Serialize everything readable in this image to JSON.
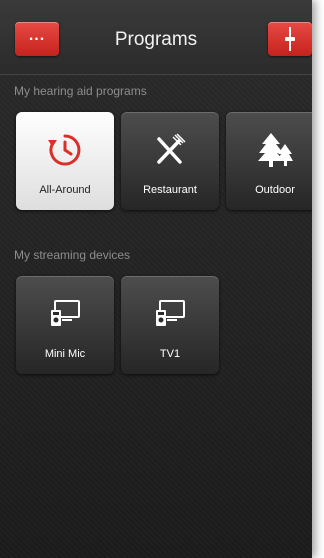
{
  "header": {
    "title": "Programs",
    "menu_icon": "ellipsis-icon",
    "adjust_icon": "slider-icon",
    "accent": "#d9302a"
  },
  "hearing_programs": {
    "label": "My hearing aid programs",
    "items": [
      {
        "label": "All-Around",
        "icon": "clock-refresh-icon",
        "selected": true
      },
      {
        "label": "Restaurant",
        "icon": "fork-knife-icon",
        "selected": false
      },
      {
        "label": "Outdoor",
        "icon": "trees-icon",
        "selected": false
      }
    ]
  },
  "streaming_devices": {
    "label": "My streaming devices",
    "items": [
      {
        "label": "Mini Mic",
        "icon": "streaming-device-icon"
      },
      {
        "label": "TV1",
        "icon": "streaming-device-icon"
      }
    ]
  }
}
